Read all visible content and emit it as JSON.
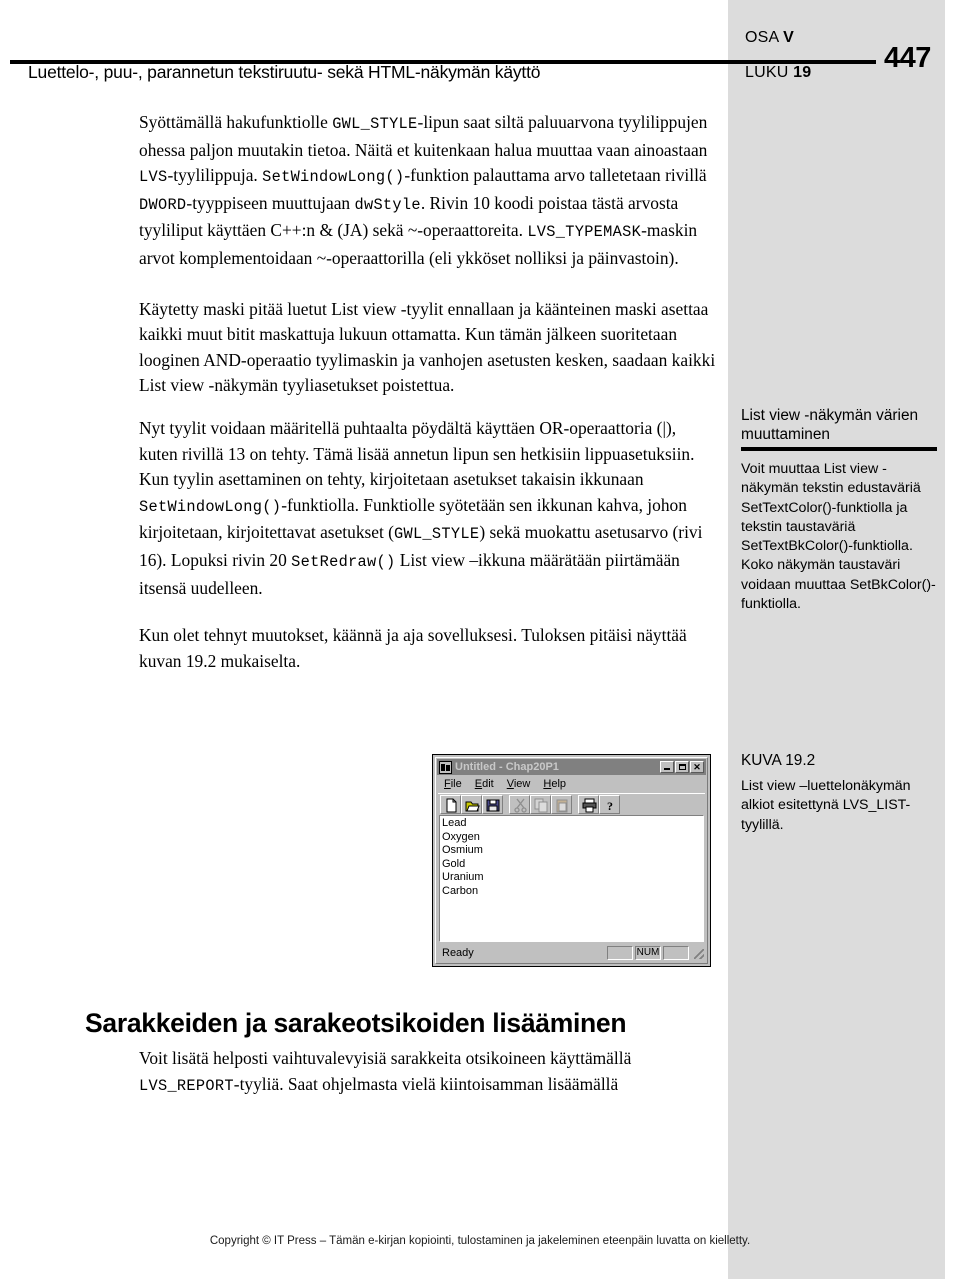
{
  "header": {
    "running_head": "Luettelo-, puu-, parannetun tekstiruutu- sekä HTML-näkymän käyttö",
    "part_label": "OSA",
    "part_value": "V",
    "chapter_label": "LUKU",
    "chapter_value": "19",
    "page_number": "447"
  },
  "body": {
    "p1": {
      "t1": "Syöttämällä hakufunktiolle ",
      "c1": "GWL_STYLE",
      "t2": "-lipun saat siltä paluuarvona tyylilippujen ohessa paljon muutakin tietoa. Näitä et kuitenkaan halua muuttaa vaan ainoastaan ",
      "c2": "LVS",
      "t3": "-tyylilippuja. ",
      "c3": "SetWindowLong()",
      "t4": "-funktion palauttama arvo talletetaan rivillä ",
      "c4": "DWORD",
      "t5": "-tyyppiseen muuttujaan ",
      "c5": "dwStyle",
      "t6": ". Rivin 10 koodi poistaa tästä arvosta tyyliliput käyttäen C++:n & (JA) sekä ~-operaattoreita. ",
      "c6": "LVS_TYPEMASK",
      "t7": "-maskin arvot komplementoidaan ~-operaattorilla (eli ykköset nolliksi ja päinvastoin)."
    },
    "p2": "Käytetty maski pitää luetut List view -tyylit ennallaan ja käänteinen maski asettaa kaikki muut bitit maskattuja lukuun ottamatta. Kun tämän jälkeen suoritetaan looginen AND-operaatio tyylimaskin ja vanhojen asetusten kesken, saadaan kaikki List view -näkymän tyyliasetukset poistettua.",
    "p3": {
      "t1": "Nyt tyylit voidaan määritellä puhtaalta pöydältä käyttäen OR-operaattoria (|), kuten rivillä 13 on tehty. Tämä lisää annetun lipun sen hetkisiin lippuasetuksiin. Kun tyylin asettaminen on tehty, kirjoitetaan asetukset takaisin ikkunaan ",
      "c1": "SetWindowLong()",
      "t2": "-funktiolla. Funktiolle syötetään sen ikkunan kahva, johon kirjoitetaan, kirjoitettavat asetukset (",
      "c2": "GWL_STYLE",
      "t3": ") sekä muokattu asetusarvo (rivi 16). Lopuksi rivin 20 ",
      "c3": "SetRedraw()",
      "t4": " List view –ikkuna määrätään piirtämään itsensä uudelleen."
    },
    "p4": "Kun olet tehnyt muutokset, käännä ja aja sovelluksesi. Tuloksen pitäisi näyttää kuvan 19.2 mukaiselta."
  },
  "note": {
    "title": "List view -näkymän värien muuttaminen",
    "text": "Voit muuttaa List view -näkymän tekstin edustaväriä SetTextColor()-funktiolla ja tekstin taustaväriä SetTextBkColor()-funktiolla. Koko näkymän taustaväri voidaan muuttaa SetBkColor()-funktiolla."
  },
  "figure_caption": {
    "label": "KUVA 19.2",
    "text": "List view –luettelonäkymän alkiot esitettynä LVS_LIST-tyylillä."
  },
  "figure_window": {
    "title": "Untitled - Chap20P1",
    "buttons": {
      "minimize": "_",
      "maximize": "□",
      "close": "✕"
    },
    "menus": [
      "File",
      "Edit",
      "View",
      "Help"
    ],
    "toolbar": [
      "new-icon",
      "open-icon",
      "save-icon",
      "cut-icon",
      "copy-icon",
      "paste-icon",
      "print-icon",
      "about-icon"
    ],
    "list_items": [
      "Lead",
      "Oxygen",
      "Osmium",
      "Gold",
      "Uranium",
      "Carbon"
    ],
    "status": {
      "message": "Ready",
      "pane1": "",
      "pane2": "NUM",
      "pane3": ""
    }
  },
  "section": {
    "heading": "Sarakkeiden ja sarakeotsikoiden lisääminen",
    "p1": {
      "t1": "Voit lisätä helposti vaihtuvalevyisiä sarakkeita otsikoineen käyttämällä ",
      "c1": "LVS_REPORT",
      "t2": "-tyyliä. Saat ohjelmasta vielä kiintoisamman lisäämällä"
    }
  },
  "footer": {
    "text": "Copyright © IT Press – Tämän e-kirjan kopiointi, tulostaminen ja jakeleminen eteenpäin luvatta on kielletty."
  },
  "colors": {
    "gray_panel": "#dcdcdc",
    "win_face": "#c0c0c0",
    "win_titlebar": "#808080",
    "win_title_text": "#c8c8c8"
  }
}
